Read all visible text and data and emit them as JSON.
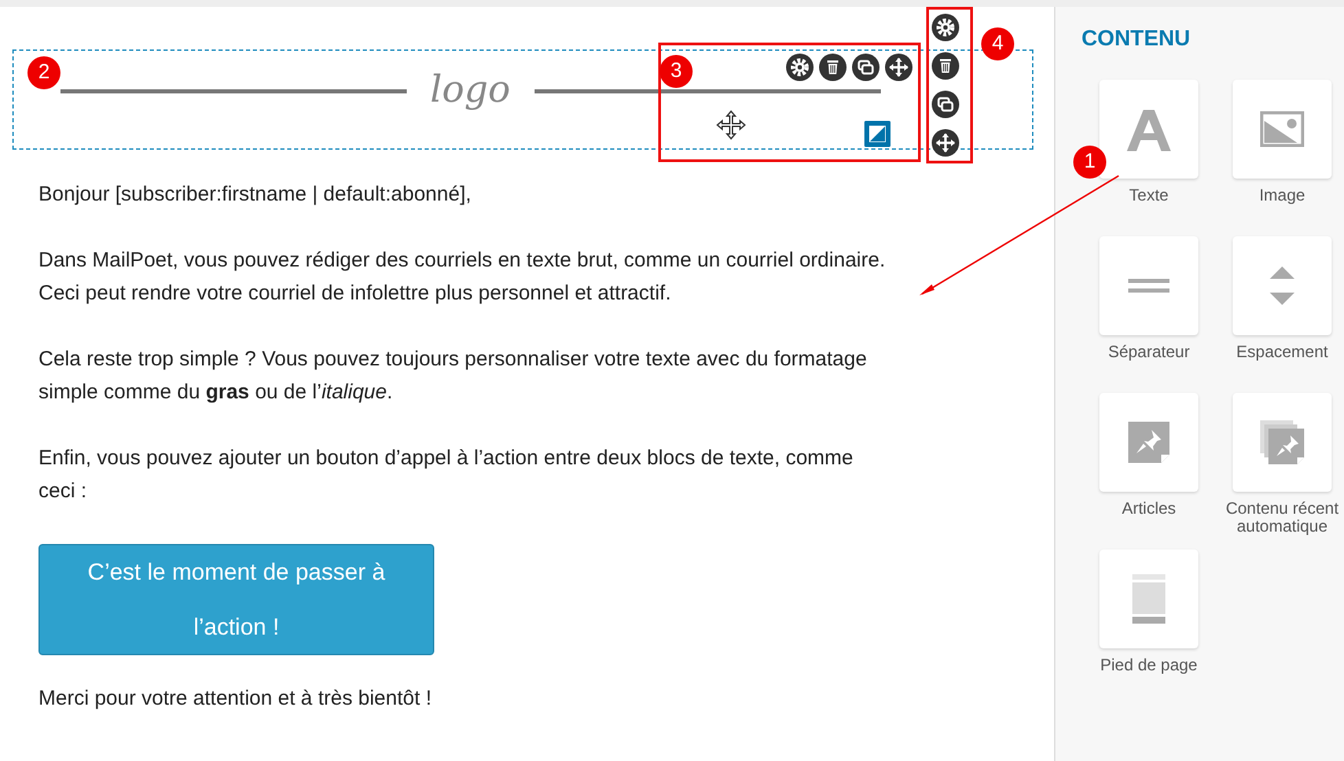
{
  "header_block": {
    "logo": "logo"
  },
  "paragraphs": [
    "Bonjour [subscriber:firstname | default:abonné],",
    "Dans MailPoet, vous pouvez rédiger des courriels en texte brut, comme un courriel ordinaire. Ceci peut rendre votre courriel de infolettre plus personnel et attractif.",
    "Cela reste trop simple ? Vous pouvez toujours personnaliser votre texte avec du formatage simple comme du **gras** ou de l’*italique*.",
    "Enfin, vous pouvez ajouter un bouton d’appel à l’action entre deux blocs de texte, comme ceci :"
  ],
  "cta_button": {
    "label": "C’est le moment de passer à l’action !"
  },
  "closing": "Merci pour votre attention et à très bientôt !",
  "sidebar": {
    "title": "CONTENU",
    "blocks": [
      {
        "kind": "text",
        "label": "Texte"
      },
      {
        "kind": "image",
        "label": "Image"
      },
      {
        "kind": "divider",
        "label": "Séparateur"
      },
      {
        "kind": "spacer",
        "label": "Espacement"
      },
      {
        "kind": "posts",
        "label": "Articles"
      },
      {
        "kind": "auto_posts",
        "label": "Contenu récent automatique"
      },
      {
        "kind": "footer",
        "label": "Pied de page"
      }
    ]
  },
  "annotations": [
    {
      "number": "1"
    },
    {
      "number": "2"
    },
    {
      "number": "3"
    },
    {
      "number": "4"
    }
  ]
}
